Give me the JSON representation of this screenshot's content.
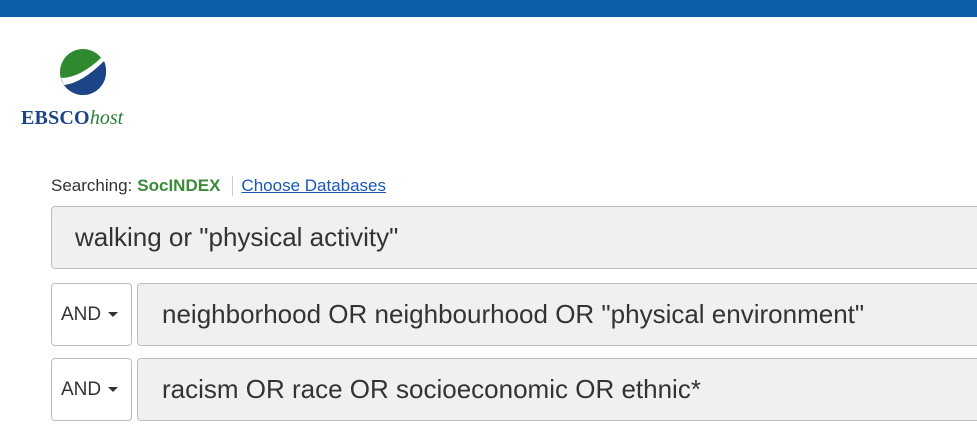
{
  "header": {
    "bar_color": "#0f5ea8"
  },
  "logo": {
    "brand": "EBSCO",
    "suffix": "host"
  },
  "searching": {
    "label": "Searching:",
    "database": "SocINDEX",
    "choose_link": "Choose Databases"
  },
  "search_rows": [
    {
      "operator": null,
      "query": "walking or \"physical activity\""
    },
    {
      "operator": "AND",
      "query": "neighborhood OR neighbourhood OR \"physical environment\""
    },
    {
      "operator": "AND",
      "query": "racism OR race OR socioeconomic OR ethnic*"
    }
  ],
  "icons": {
    "operator_dropdown": "caret-down-icon",
    "logo": "ebsco-globe-icon"
  }
}
